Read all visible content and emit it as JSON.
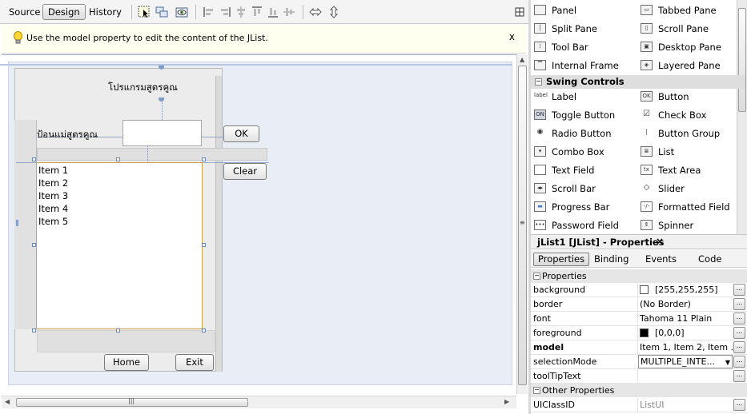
{
  "toolbar": {
    "tabs": [
      "Source",
      "Design",
      "History"
    ],
    "active_tab": "Design"
  },
  "hint": {
    "text": "Use the model property to edit the content of the JList.",
    "close": "x"
  },
  "form": {
    "title_label": "โปรแกรมสูตรคูณ",
    "input_label": "ป้อนแม่สูตรคูณ",
    "ok_button": "OK",
    "clear_button": "Clear",
    "home_button": "Home",
    "exit_button": "Exit",
    "list_items": [
      "Item 1",
      "Item 2",
      "Item 3",
      "Item 4",
      "Item 5"
    ]
  },
  "palette": {
    "containers": [
      {
        "label": "Panel",
        "icon": "panel-icon"
      },
      {
        "label": "Tabbed Pane",
        "icon": "tabbed-pane-icon"
      },
      {
        "label": "Split Pane",
        "icon": "split-pane-icon"
      },
      {
        "label": "Scroll Pane",
        "icon": "scroll-pane-icon"
      },
      {
        "label": "Tool Bar",
        "icon": "tool-bar-icon"
      },
      {
        "label": "Desktop Pane",
        "icon": "desktop-pane-icon"
      },
      {
        "label": "Internal Frame",
        "icon": "internal-frame-icon"
      },
      {
        "label": "Layered Pane",
        "icon": "layered-pane-icon"
      }
    ],
    "category": "Swing Controls",
    "controls": [
      {
        "label": "Label",
        "icon": "label-icon",
        "glyph": "label"
      },
      {
        "label": "Button",
        "icon": "button-icon",
        "glyph": "OK"
      },
      {
        "label": "Toggle Button",
        "icon": "toggle-button-icon",
        "glyph": "ON"
      },
      {
        "label": "Check Box",
        "icon": "check-box-icon",
        "glyph": "☑"
      },
      {
        "label": "Radio Button",
        "icon": "radio-button-icon",
        "glyph": "◉"
      },
      {
        "label": "Button Group",
        "icon": "button-group-icon",
        "glyph": "⁝"
      },
      {
        "label": "Combo Box",
        "icon": "combo-box-icon",
        "glyph": "▾"
      },
      {
        "label": "List",
        "icon": "list-icon",
        "glyph": "≣"
      },
      {
        "label": "Text Field",
        "icon": "text-field-icon",
        "glyph": ""
      },
      {
        "label": "Text Area",
        "icon": "text-area-icon",
        "glyph": "tx"
      },
      {
        "label": "Scroll Bar",
        "icon": "scroll-bar-icon",
        "glyph": "◂▸"
      },
      {
        "label": "Slider",
        "icon": "slider-icon",
        "glyph": "◇"
      },
      {
        "label": "Progress Bar",
        "icon": "progress-bar-icon",
        "glyph": "▬"
      },
      {
        "label": "Formatted Field",
        "icon": "formatted-field-icon",
        "glyph": "-/-"
      },
      {
        "label": "Password Field",
        "icon": "password-field-icon",
        "glyph": "•••"
      },
      {
        "label": "Spinner",
        "icon": "spinner-icon",
        "glyph": "⇕"
      }
    ]
  },
  "properties": {
    "title": "jList1 [JList] - Properties",
    "close": "×",
    "tabs": [
      "Properties",
      "Binding",
      "Events",
      "Code"
    ],
    "active_tab": "Properties",
    "section1": "Properties",
    "rows": [
      {
        "name": "background",
        "value": "[255,255,255]",
        "swatch": "#ffffff"
      },
      {
        "name": "border",
        "value": "(No Border)"
      },
      {
        "name": "font",
        "value": "Tahoma 11 Plain"
      },
      {
        "name": "foreground",
        "value": "[0,0,0]",
        "swatch": "#000000"
      },
      {
        "name": "model",
        "value": "Item 1, Item 2, Item ..."
      },
      {
        "name": "selectionMode",
        "value": "MULTIPLE_INTE..."
      },
      {
        "name": "toolTipText",
        "value": ""
      }
    ],
    "section2": "Other Properties",
    "other_rows": [
      {
        "name": "UIClassID",
        "value": "ListUI"
      }
    ],
    "ellipsis": "..."
  }
}
